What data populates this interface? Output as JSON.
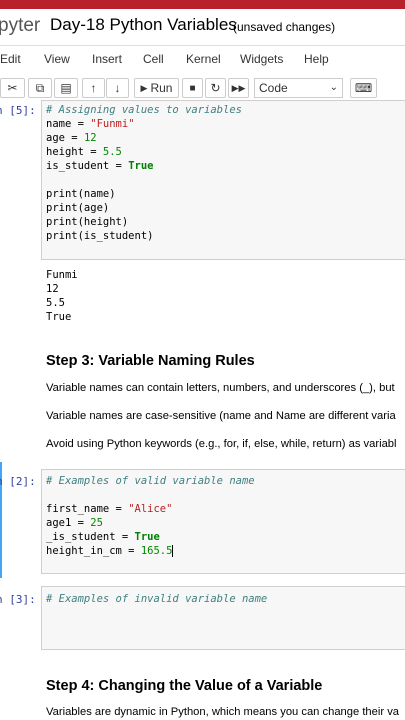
{
  "header": {
    "logo_text": "pyter",
    "notebook_title": "Day-18 Python Variables",
    "status": "(unsaved changes)"
  },
  "menu": [
    "Edit",
    "View",
    "Insert",
    "Cell",
    "Kernel",
    "Widgets",
    "Help"
  ],
  "toolbar": {
    "run_label": "Run",
    "cell_type": "Code"
  },
  "cells": {
    "c1": {
      "prompt": "n [5]:",
      "comment": "# Assigning values to variables",
      "l_name_var": "name = ",
      "l_name_val": "\"Funmi\"",
      "l_age_var": "age = ",
      "l_age_val": "12",
      "l_height_var": "height = ",
      "l_height_val": "5.5",
      "l_student_var": "is_student = ",
      "l_student_val": "True",
      "p1": "print(name)",
      "p2": "print(age)",
      "p3": "print(height)",
      "p4": "print(is_student)",
      "outputs": [
        "Funmi",
        "12",
        "5.5",
        "True"
      ]
    },
    "md1": {
      "heading": "Step 3: Variable Naming Rules",
      "lines": [
        "Variable names can contain letters, numbers, and underscores (_), but",
        "Variable names are case-sensitive (name and Name are different varia",
        "Avoid using Python keywords (e.g., for, if, else, while, return) as variabl"
      ]
    },
    "c2": {
      "prompt": "n [2]:",
      "comment": "# Examples of valid variable name",
      "l1_var": "first_name = ",
      "l1_val": "\"Alice\"",
      "l2_var": "age1 = ",
      "l2_val": "25",
      "l3_var": "_is_student = ",
      "l3_val": "True",
      "l4_var": "height_in_cm = ",
      "l4_val": "165.5"
    },
    "c3": {
      "prompt": "n [3]:",
      "comment": "# Examples of invalid variable name"
    },
    "md2": {
      "heading": "Step 4: Changing the Value of a Variable",
      "line": "Variables are dynamic in Python, which means you can change their va"
    }
  },
  "icons": [
    "cut-icon",
    "copy-icon",
    "paste-icon",
    "move-up-icon",
    "move-down-icon",
    "run-icon",
    "stop-icon",
    "restart-icon",
    "fast-forward-icon",
    "chevron-down-icon",
    "keyboard-icon"
  ]
}
